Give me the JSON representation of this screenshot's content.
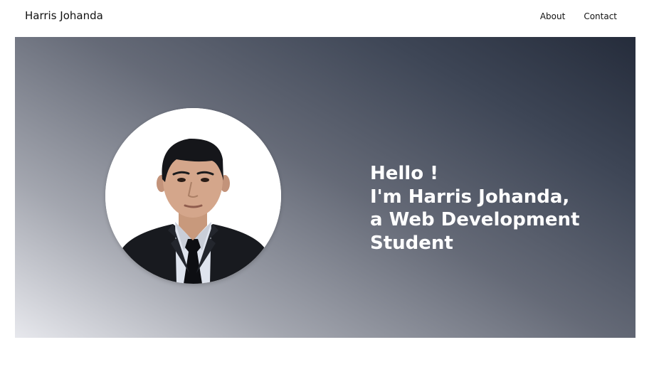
{
  "navbar": {
    "brand": "Harris Johanda",
    "links": [
      "About",
      "Contact"
    ]
  },
  "hero": {
    "greeting_lines": [
      "Hello !",
      "I'm Harris Johanda,",
      "a Web Development",
      "Student"
    ],
    "portrait": "person-portrait"
  },
  "colors": {
    "hero_gradient_light": "#e7e8ed",
    "hero_gradient_dark": "#252c3b",
    "hero_text": "#ffffff",
    "nav_text": "#111111"
  }
}
